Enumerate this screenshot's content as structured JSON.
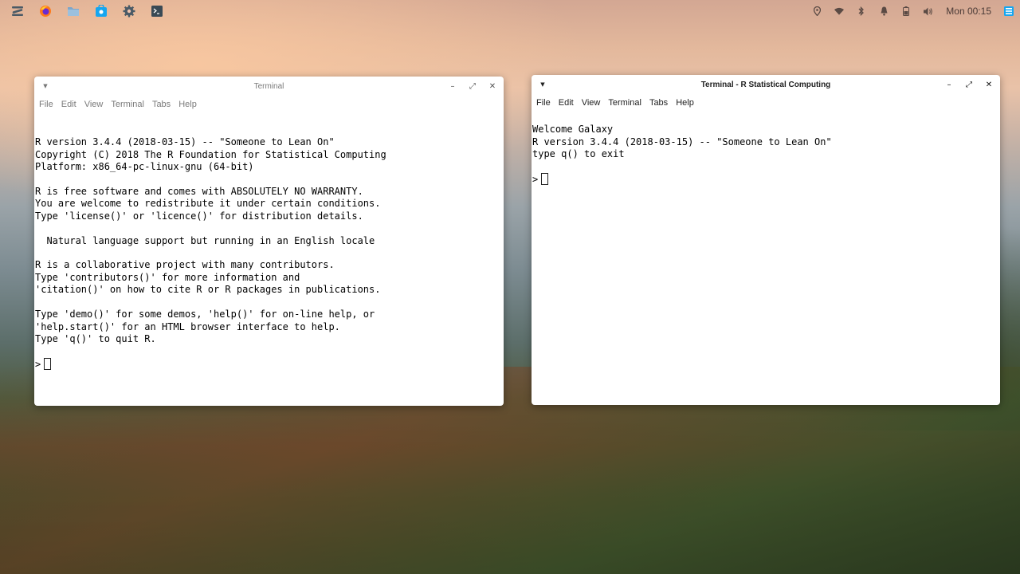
{
  "panel": {
    "apps": [
      {
        "name": "zorin-menu-icon",
        "label": "Zorin menu"
      },
      {
        "name": "firefox-icon",
        "label": "Firefox"
      },
      {
        "name": "files-icon",
        "label": "Files"
      },
      {
        "name": "software-icon",
        "label": "Software"
      },
      {
        "name": "settings-icon",
        "label": "Settings"
      },
      {
        "name": "terminal-icon",
        "label": "Terminal"
      }
    ],
    "tray": [
      "location-icon",
      "wifi-icon",
      "bluetooth-icon",
      "notifications-icon",
      "battery-icon",
      "volume-icon"
    ],
    "clock": "Mon 00:15",
    "accent": "#15a6f0"
  },
  "left_window": {
    "title": "Terminal",
    "menu": [
      "File",
      "Edit",
      "View",
      "Terminal",
      "Tabs",
      "Help"
    ],
    "lines": [
      "R version 3.4.4 (2018-03-15) -- \"Someone to Lean On\"",
      "Copyright (C) 2018 The R Foundation for Statistical Computing",
      "Platform: x86_64-pc-linux-gnu (64-bit)",
      "",
      "R is free software and comes with ABSOLUTELY NO WARRANTY.",
      "You are welcome to redistribute it under certain conditions.",
      "Type 'license()' or 'licence()' for distribution details.",
      "",
      "  Natural language support but running in an English locale",
      "",
      "R is a collaborative project with many contributors.",
      "Type 'contributors()' for more information and",
      "'citation()' on how to cite R or R packages in publications.",
      "",
      "Type 'demo()' for some demos, 'help()' for on-line help, or",
      "'help.start()' for an HTML browser interface to help.",
      "Type 'q()' to quit R.",
      ""
    ],
    "prompt": ">"
  },
  "right_window": {
    "title": "Terminal - R Statistical Computing",
    "menu": [
      "File",
      "Edit",
      "View",
      "Terminal",
      "Tabs",
      "Help"
    ],
    "lines": [
      "Welcome Galaxy",
      "R version 3.4.4 (2018-03-15) -- \"Someone to Lean On\"",
      "type q() to exit",
      ""
    ],
    "prompt": ">"
  }
}
